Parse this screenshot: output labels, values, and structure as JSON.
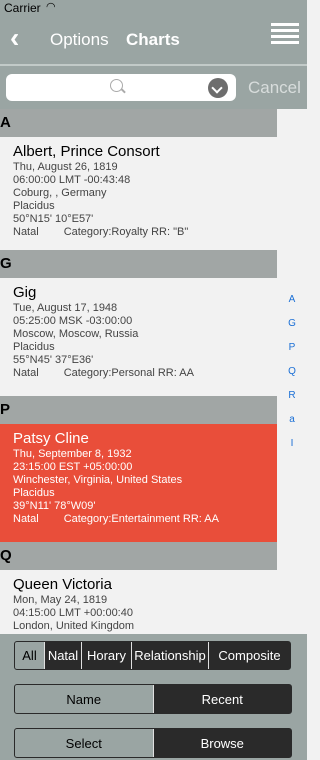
{
  "status": {
    "carrier": "Carrier"
  },
  "nav": {
    "back_label": "Options",
    "title": "Charts"
  },
  "search": {
    "placeholder": "",
    "cancel_label": "Cancel"
  },
  "sections": [
    {
      "letter": "A",
      "rows": [
        {
          "name": "Albert, Prince Consort",
          "date": "Thu, August 26, 1819",
          "time": "06:00:00 LMT -00:43:48",
          "place": "Coburg, , Germany",
          "house": "Placidus",
          "coords": "50°N15' 10°E57'",
          "type": "Natal",
          "category": "Category:Royalty",
          "rr": "RR: \"B\""
        }
      ]
    },
    {
      "letter": "G",
      "rows": [
        {
          "name": "Gig",
          "date": "Tue, August 17, 1948",
          "time": "05:25:00 MSK -03:00:00",
          "place": "Moscow, Moscow, Russia",
          "house": "Placidus",
          "coords": "55°N45' 37°E36'",
          "type": "Natal",
          "category": "Category:Personal",
          "rr": "RR: AA"
        }
      ]
    },
    {
      "letter": "P",
      "rows": [
        {
          "name": "Patsy Cline",
          "date": "Thu, September 8, 1932",
          "time": "23:15:00 EST +05:00:00",
          "place": "Winchester, Virginia, United States",
          "house": "Placidus",
          "coords": "39°N11' 78°W09'",
          "type": "Natal",
          "category": "Category:Entertainment",
          "rr": "RR: AA"
        }
      ]
    },
    {
      "letter": "Q",
      "rows": [
        {
          "name": "Queen Victoria",
          "date": "Mon, May 24, 1819",
          "time": "04:15:00 LMT +00:00:40",
          "place": "London, United Kingdom",
          "house": "",
          "coords": "",
          "type": "",
          "category": "",
          "rr": ""
        }
      ]
    }
  ],
  "index_letters": [
    "A",
    "G",
    "P",
    "Q",
    "R",
    "a",
    "I"
  ],
  "filters": [
    "All",
    "Natal",
    "Horary",
    "Relationship",
    "Composite"
  ],
  "filter_selected": "All",
  "sort": [
    "Name",
    "Recent"
  ],
  "sort_selected": "Name",
  "mode": [
    "Select",
    "Browse"
  ],
  "mode_selected": "Select",
  "colors": {
    "bar": "#9aa5a3",
    "highlight": "#e94e3a",
    "index": "#1a6fd6"
  }
}
